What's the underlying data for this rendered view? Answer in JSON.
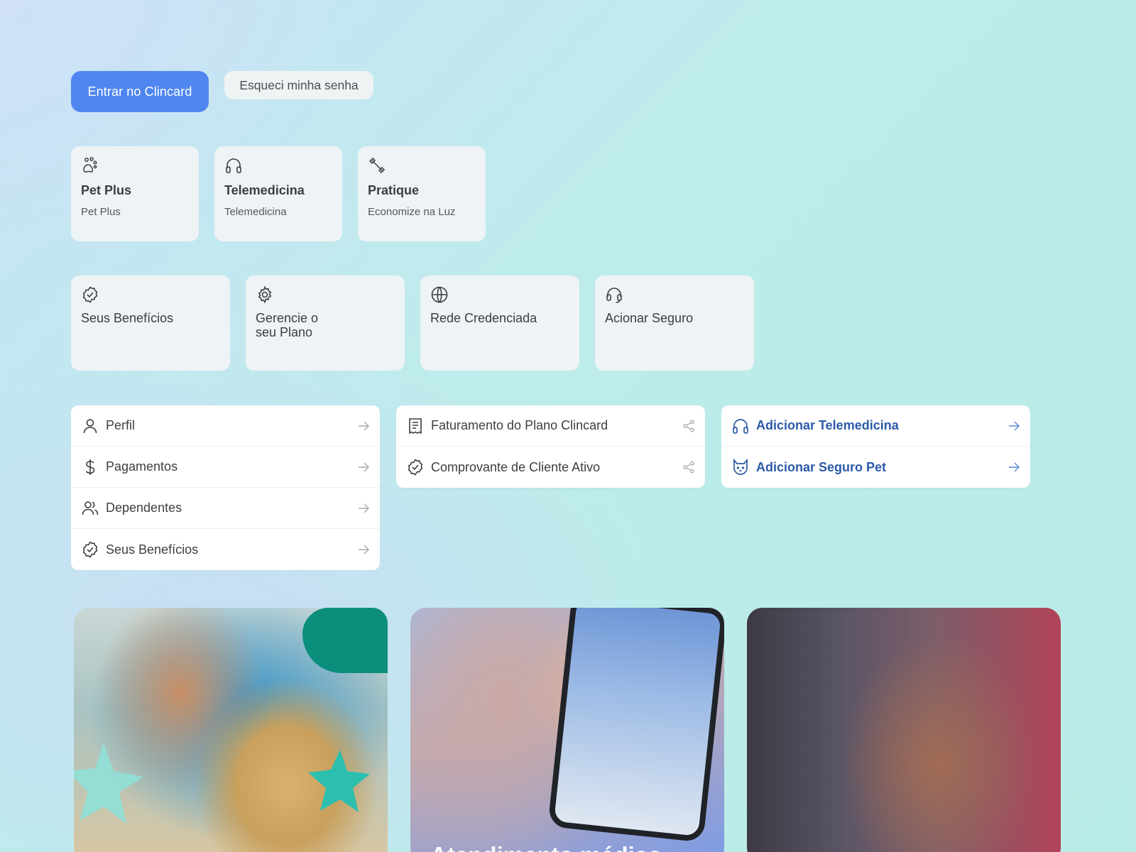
{
  "top_actions": {
    "login_label": "Entrar no Clincard",
    "forgot_label": "Esqueci minha senha"
  },
  "service_cards": [
    {
      "icon": "paw-icon",
      "title": "Pet Plus",
      "subtitle": "Pet Plus"
    },
    {
      "icon": "headphones-icon",
      "title": "Telemedicina",
      "subtitle": "Telemedicina"
    },
    {
      "icon": "dumbbell-icon",
      "title": "Pratique",
      "subtitle": "Economize na Luz"
    }
  ],
  "quick_cards": [
    {
      "icon": "badge-check-icon",
      "title": "Seus Benefícios"
    },
    {
      "icon": "gear-icon",
      "title_line1": "Gerencie o",
      "title_line2": "seu Plano"
    },
    {
      "icon": "globe-icon",
      "title": "Rede Credenciada"
    },
    {
      "icon": "headset-icon",
      "title": "Acionar Seguro"
    }
  ],
  "account_list": [
    {
      "icon": "user-icon",
      "label": "Perfil"
    },
    {
      "icon": "dollar-icon",
      "label": "Pagamentos"
    },
    {
      "icon": "users-icon",
      "label": "Dependentes"
    },
    {
      "icon": "badge-check-icon",
      "label": "Seus Benefícios"
    }
  ],
  "documents_list": [
    {
      "icon": "receipt-icon",
      "label": "Faturamento do Plano Clincard"
    },
    {
      "icon": "badge-check-icon",
      "label": "Comprovante de Cliente Ativo"
    }
  ],
  "add_list": [
    {
      "icon": "headphones-icon",
      "label": "Adicionar Telemedicina"
    },
    {
      "icon": "cat-icon",
      "label": "Adicionar Seguro Pet"
    }
  ],
  "promo_cards": [
    {
      "image": "vet-with-dog-photo",
      "title": ""
    },
    {
      "image": "senior-on-phone-photo",
      "title": "Atendimento médico"
    },
    {
      "image": "woman-at-gym-photo",
      "title": ""
    }
  ],
  "colors": {
    "primary": "#4f86f0",
    "link_blue": "#2b5aa8",
    "card_bg": "#eef3f5"
  }
}
